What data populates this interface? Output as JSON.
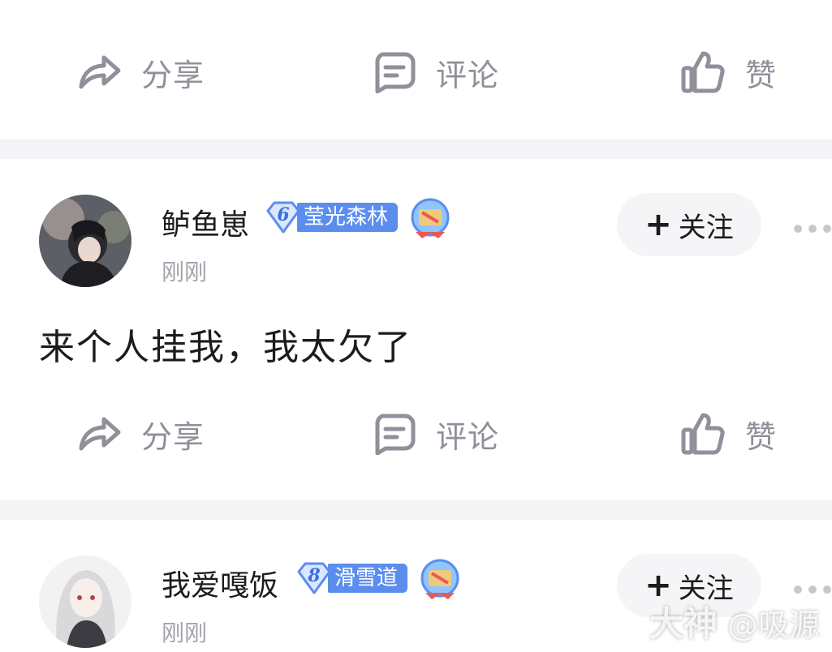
{
  "actions": {
    "share_label": "分享",
    "comment_label": "评论",
    "like_label": "赞"
  },
  "posts": [
    {
      "username": "鲈鱼崽",
      "level": "6",
      "level_name": "莹光森林",
      "timestamp": "刚刚",
      "follow_label": "关注",
      "content": "来个人挂我，我太欠了"
    },
    {
      "username": "我爱嘎饭",
      "level": "8",
      "level_name": "滑雪道",
      "timestamp": "刚刚",
      "follow_label": "关注"
    }
  ],
  "watermark": {
    "brand": "大神",
    "handle": "@吸源"
  },
  "colors": {
    "icon_gray": "#8f9099",
    "badge_blue": "#5b8def",
    "divider": "#f4f4f6"
  },
  "icons": [
    "share-icon",
    "comment-icon",
    "like-icon",
    "level-gem-icon",
    "medal-icon",
    "more-icon",
    "plus-icon"
  ]
}
